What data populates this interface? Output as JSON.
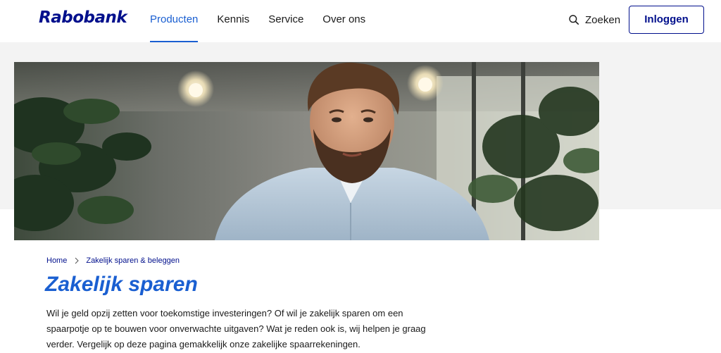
{
  "header": {
    "logo": "Rabobank",
    "nav": [
      {
        "label": "Producten",
        "active": true
      },
      {
        "label": "Kennis",
        "active": false
      },
      {
        "label": "Service",
        "active": false
      },
      {
        "label": "Over ons",
        "active": false
      }
    ],
    "search_label": "Zoeken",
    "search_icon": "search-icon",
    "login_label": "Inloggen"
  },
  "hero": {
    "image": "portrait-bearded-man-office",
    "icon": "hero-photo"
  },
  "breadcrumb": {
    "items": [
      "Home",
      "Zakelijk sparen & beleggen"
    ],
    "separator_icon": "chevron-right-icon"
  },
  "main": {
    "title": "Zakelijk sparen",
    "intro": "Wil je geld opzij zetten voor toekomstige investeringen? Of wil je zakelijk sparen om een spaarpotje op te bouwen voor onverwachte uitgaven? Wat je reden ook is, wij helpen je graag verder. Vergelijk op deze pagina gemakkelijk onze zakelijke spaarrekeningen."
  },
  "colors": {
    "brand_navy": "#000f8c",
    "accent_blue": "#1a5fd1",
    "band_gray": "#f3f3f3"
  }
}
